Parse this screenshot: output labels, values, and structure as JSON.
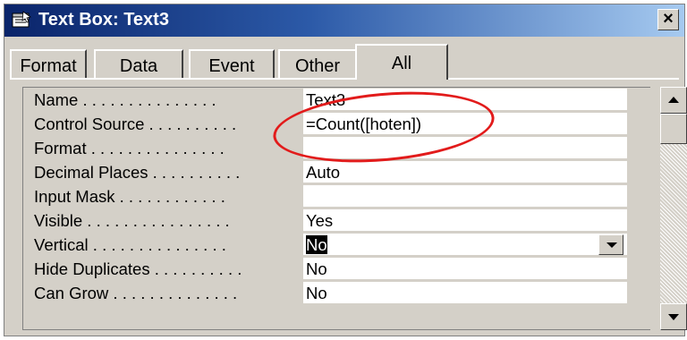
{
  "window": {
    "title": "Text Box: Text3",
    "close_label": "×"
  },
  "tabs": [
    {
      "label": "Format"
    },
    {
      "label": "Data"
    },
    {
      "label": "Event"
    },
    {
      "label": "Other"
    },
    {
      "label": "All",
      "active": true
    }
  ],
  "properties": [
    {
      "name": "Name . . . . . . . . . . . . . . .",
      "value": "Text3"
    },
    {
      "name": "Control Source . . . . . . . . . .",
      "value": "=Count([hoten])"
    },
    {
      "name": "Format . . . . . . . . . . . . . . .",
      "value": ""
    },
    {
      "name": "Decimal Places . . . . . . . . . .",
      "value": "Auto"
    },
    {
      "name": "Input Mask . . . . . . . . . . . .",
      "value": ""
    },
    {
      "name": "Visible . . . . . . . . . . . . . . . .",
      "value": "Yes"
    },
    {
      "name": "Vertical . . . . . . . . . . . . . . .",
      "value": "No",
      "selected": true,
      "dropdown": true
    },
    {
      "name": "Hide Duplicates . . . . . . . . . .",
      "value": "No"
    },
    {
      "name": "Can Grow . . . . . . . . . . . . . .",
      "value": "No"
    }
  ],
  "annotation": {
    "color": "#e21b1b",
    "target": "Control Source value"
  },
  "colors": {
    "title_start": "#0a246a",
    "title_end": "#a6caf0",
    "face": "#d4d0c8"
  }
}
